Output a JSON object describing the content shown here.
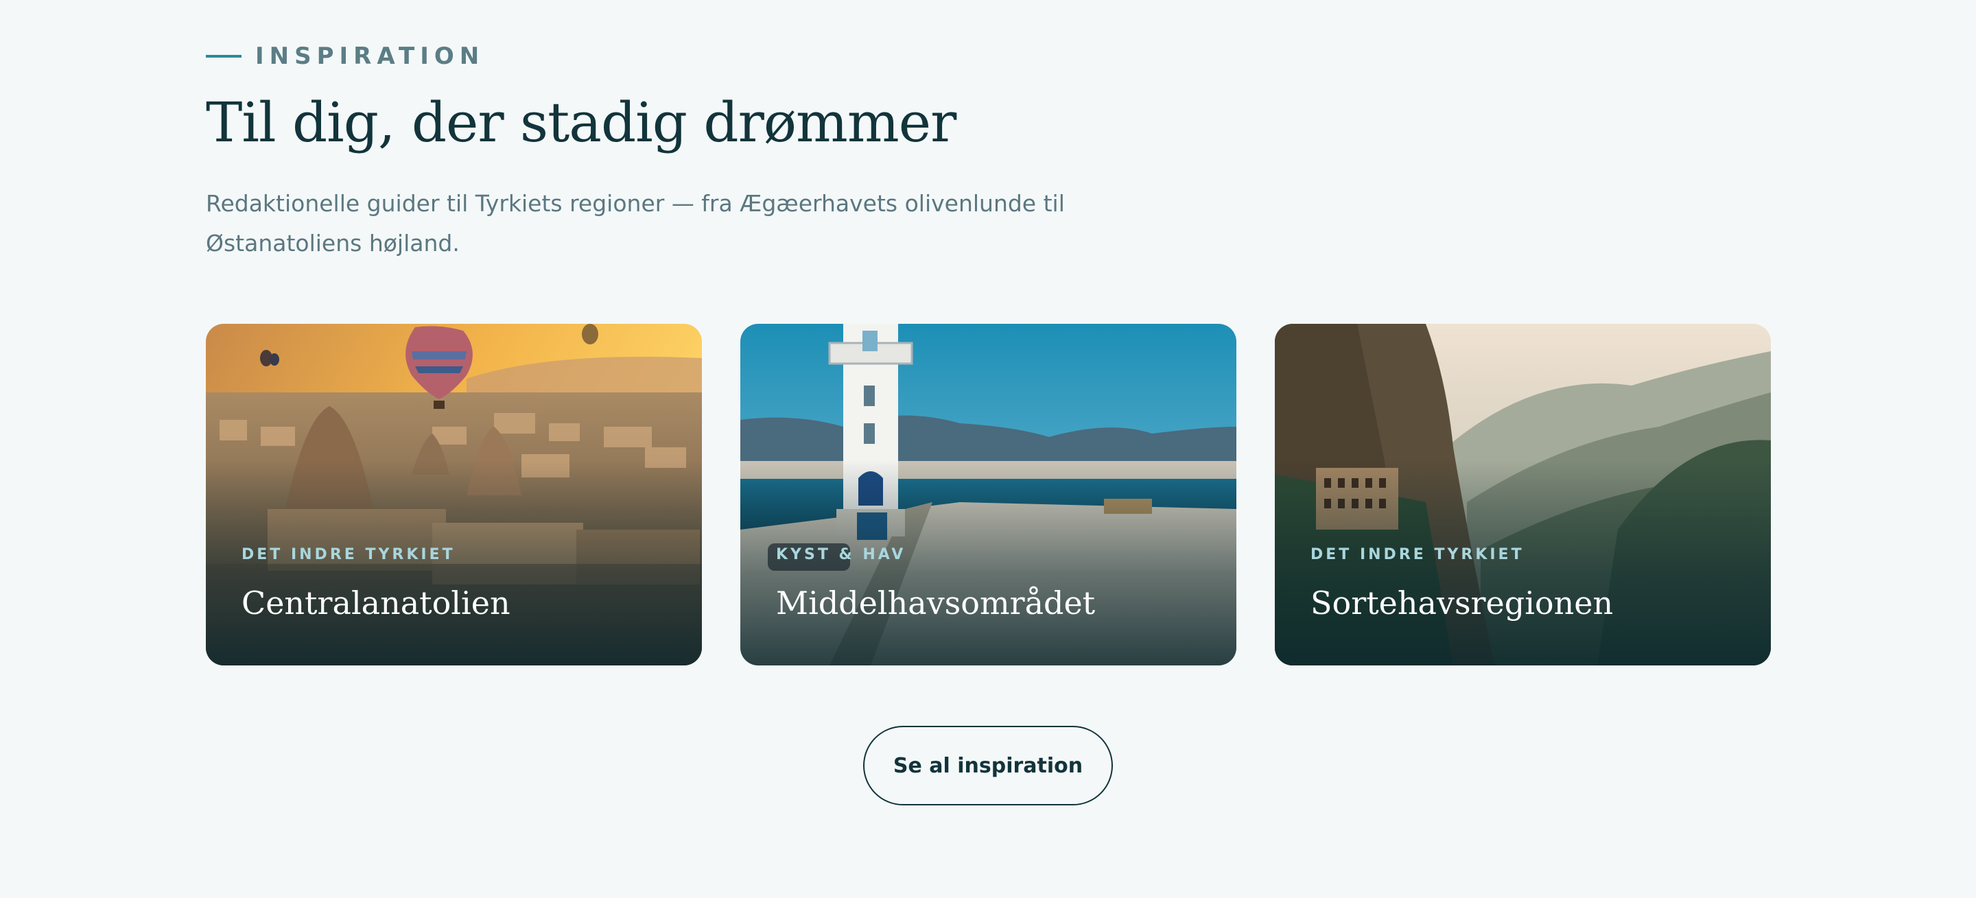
{
  "section": {
    "eyebrow": "INSPIRATION",
    "title": "Til dig, der stadig drømmer",
    "lead": "Redaktionelle guider til Tyrkiets regioner — fra Ægæerhavets olivenlunde til Østanatoliens højland."
  },
  "cards": [
    {
      "kicker": "DET INDRE TYRKIET",
      "title": "Centralanatolien",
      "image": "cappadocia-balloons"
    },
    {
      "kicker": "KYST & HAV",
      "title": "Middelhavsområdet",
      "image": "lighthouse-harbor"
    },
    {
      "kicker": "DET INDRE TYRKIET",
      "title": "Sortehavsregionen",
      "image": "cliff-monastery-mountains"
    }
  ],
  "cta": {
    "label": "Se al inspiration"
  },
  "colors": {
    "background": "#f4f8f9",
    "heading": "#12343b",
    "accent": "#2b8a97",
    "muted": "#5b7780"
  }
}
